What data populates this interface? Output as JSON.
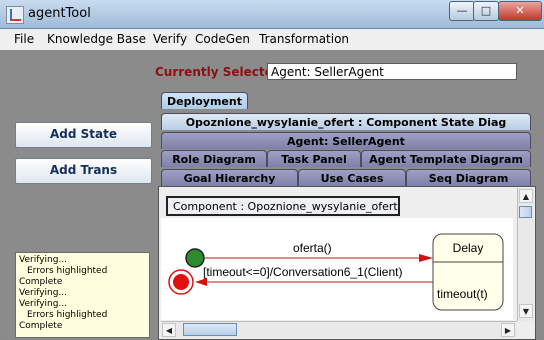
{
  "window": {
    "title": "agentTool",
    "min": "—",
    "max": "□",
    "close": "✕"
  },
  "menu": [
    "File",
    "Knowledge Base",
    "Verify",
    "CodeGen",
    "Transformation"
  ],
  "left": {
    "add_state": "Add State",
    "add_trans": "Add Trans",
    "log": [
      "Verifying...",
      "Errors highlighted",
      "Complete",
      "Verifying...",
      "Verifying...",
      "Errors highlighted",
      "Complete"
    ]
  },
  "selection": {
    "label": "Currently Selected",
    "value": "Agent: SellerAgent"
  },
  "tabs": {
    "deployment": "Deployment",
    "component_state": "Opoznione_wysylanie_ofert : Component State Diag",
    "agent": "Agent: SellerAgent",
    "role_diagram": "Role Diagram",
    "task_panel": "Task Panel",
    "agent_template": "Agent Template Diagram",
    "goal_hierarchy": "Goal Hierarchy",
    "use_cases": "Use Cases",
    "seq_diagram": "Seq Diagram"
  },
  "diagram": {
    "component_label": "Component : Opoznione_wysylanie_ofert",
    "state_name": "Delay",
    "state_activity": "timeout(t)",
    "transition_top": "oferta()",
    "transition_bottom": "[timeout<=0]/Conversation6_1(Client)",
    "start_color": "#2f8a2f",
    "end_color": "#e01010",
    "arrow_color": "#d01010"
  },
  "scroll": {
    "up": "▲",
    "down": "▼",
    "left": "◀",
    "right": "▶"
  }
}
